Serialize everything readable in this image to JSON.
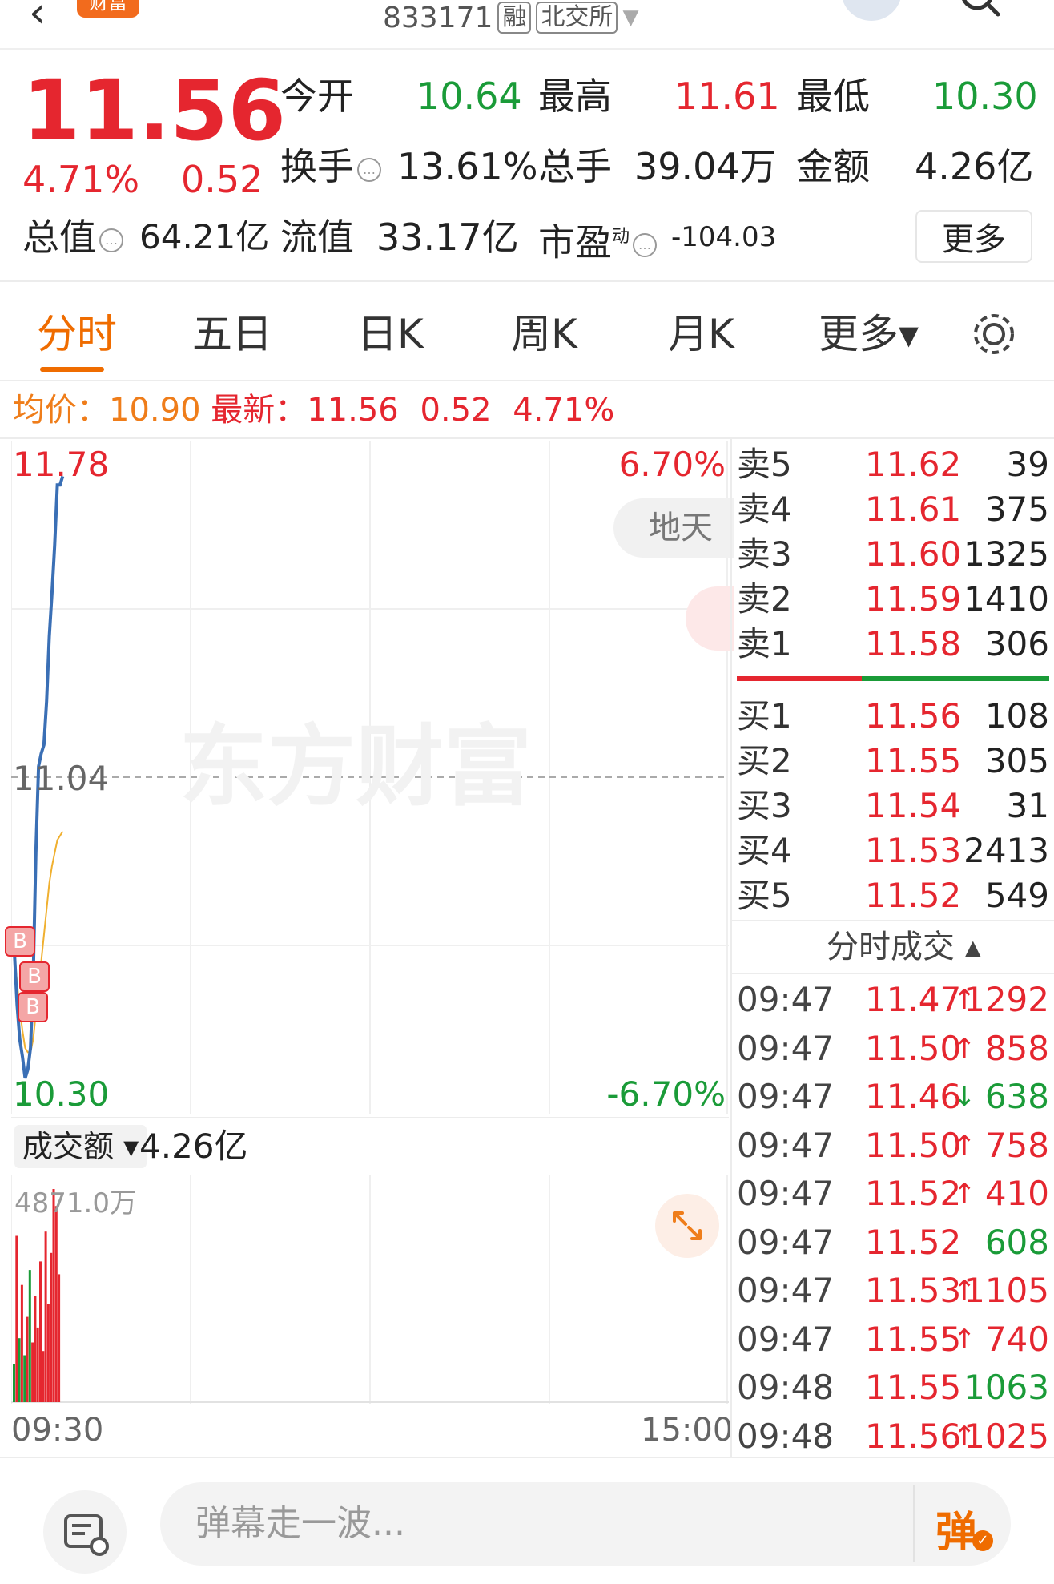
{
  "header": {
    "stock_code": "833171",
    "tag_margin": "融",
    "tag_exchange": "北交所",
    "badge": "财富"
  },
  "quote": {
    "price": "11.56",
    "change_pct": "4.71%",
    "change": "0.52",
    "open_label": "今开",
    "open": "10.64",
    "high_label": "最高",
    "high": "11.61",
    "low_label": "最低",
    "low": "10.30",
    "turnover_label": "换手",
    "turnover": "13.61%",
    "volume_label": "总手",
    "volume": "39.04万",
    "amount_label": "金额",
    "amount": "4.26亿",
    "mktcap_label": "总值",
    "mktcap": "64.21亿",
    "float_label": "流值",
    "float": "33.17亿",
    "pe_label": "市盈",
    "pe_sup": "动",
    "pe": "-104.03",
    "more_button": "更多"
  },
  "tabs": [
    "分时",
    "五日",
    "日K",
    "周K",
    "月K",
    "更多▾"
  ],
  "avgline": {
    "avg_label": "均价：",
    "avg": "10.90",
    "latest_label": "最新：",
    "latest": "11.56",
    "latest_change": "0.52",
    "latest_pct": "4.71%"
  },
  "chart": {
    "y_top": "11.78",
    "y_mid": "11.04",
    "y_bottom": "10.30",
    "pct_top": "6.70%",
    "pct_bottom": "-6.70%",
    "watermark": "东方财富",
    "overlay_text": "地天",
    "volume_selector": "成交额 ▾",
    "volume_total": "4.26亿",
    "volume_max": "4871.0万",
    "time_start": "09:30",
    "time_end": "15:00",
    "b_markers": [
      "B",
      "B",
      "B"
    ],
    "colors": {
      "price_line": "#3a6fb5",
      "avg_line": "#f0b030",
      "up": "#e5262f",
      "down": "#1a9b38"
    }
  },
  "chart_data": {
    "type": "line",
    "x": [
      "09:30",
      "09:31",
      "09:32",
      "09:33",
      "09:34",
      "09:35",
      "09:36",
      "09:37",
      "09:38",
      "09:39",
      "09:40",
      "09:41",
      "09:42",
      "09:43",
      "09:44",
      "09:45",
      "09:46",
      "09:47",
      "09:48"
    ],
    "series": [
      {
        "values": [
          10.62,
          10.5,
          10.42,
          10.38,
          10.33,
          10.35,
          10.4,
          10.56,
          10.85,
          11.05,
          11.08,
          11.1,
          11.2,
          11.35,
          11.45,
          11.56,
          11.7,
          11.7,
          11.72
        ]
      },
      {
        "values": [
          10.62,
          10.55,
          10.49,
          10.44,
          10.4,
          10.39,
          10.39,
          10.42,
          10.48,
          10.55,
          10.6,
          10.66,
          10.72,
          10.78,
          10.82,
          10.85,
          10.88,
          10.89,
          10.9
        ]
      }
    ],
    "ylim": [
      10.3,
      11.78
    ],
    "volume_ylim": [
      0,
      4871.0
    ]
  },
  "orderbook": {
    "asks": [
      {
        "label": "卖5",
        "price": "11.62",
        "vol": "39"
      },
      {
        "label": "卖4",
        "price": "11.61",
        "vol": "375"
      },
      {
        "label": "卖3",
        "price": "11.60",
        "vol": "1325"
      },
      {
        "label": "卖2",
        "price": "11.59",
        "vol": "1410"
      },
      {
        "label": "卖1",
        "price": "11.58",
        "vol": "306"
      }
    ],
    "bids": [
      {
        "label": "买1",
        "price": "11.56",
        "vol": "108"
      },
      {
        "label": "买2",
        "price": "11.55",
        "vol": "305"
      },
      {
        "label": "买3",
        "price": "11.54",
        "vol": "31"
      },
      {
        "label": "买4",
        "price": "11.53",
        "vol": "2413"
      },
      {
        "label": "买5",
        "price": "11.52",
        "vol": "549"
      }
    ],
    "ticks_title": "分时成交 ▴",
    "ticks": [
      {
        "time": "09:47",
        "price": "11.47",
        "arrow": "↑",
        "vol": "1292",
        "dir": "up"
      },
      {
        "time": "09:47",
        "price": "11.50",
        "arrow": "↑",
        "vol": "858",
        "dir": "up"
      },
      {
        "time": "09:47",
        "price": "11.46",
        "arrow": "↓",
        "vol": "638",
        "dir": "down"
      },
      {
        "time": "09:47",
        "price": "11.50",
        "arrow": "↑",
        "vol": "758",
        "dir": "up"
      },
      {
        "time": "09:47",
        "price": "11.52",
        "arrow": "↑",
        "vol": "410",
        "dir": "up"
      },
      {
        "time": "09:47",
        "price": "11.52",
        "arrow": "",
        "vol": "608",
        "dir": "down"
      },
      {
        "time": "09:47",
        "price": "11.53",
        "arrow": "↑",
        "vol": "1105",
        "dir": "up"
      },
      {
        "time": "09:47",
        "price": "11.55",
        "arrow": "↑",
        "vol": "740",
        "dir": "up"
      },
      {
        "time": "09:48",
        "price": "11.55",
        "arrow": "",
        "vol": "1063",
        "dir": "down"
      },
      {
        "time": "09:48",
        "price": "11.56",
        "arrow": "↑",
        "vol": "1025",
        "dir": "up"
      }
    ]
  },
  "bottom": {
    "danmu_placeholder": "弹幕走一波...",
    "danmu_button": "弹"
  }
}
